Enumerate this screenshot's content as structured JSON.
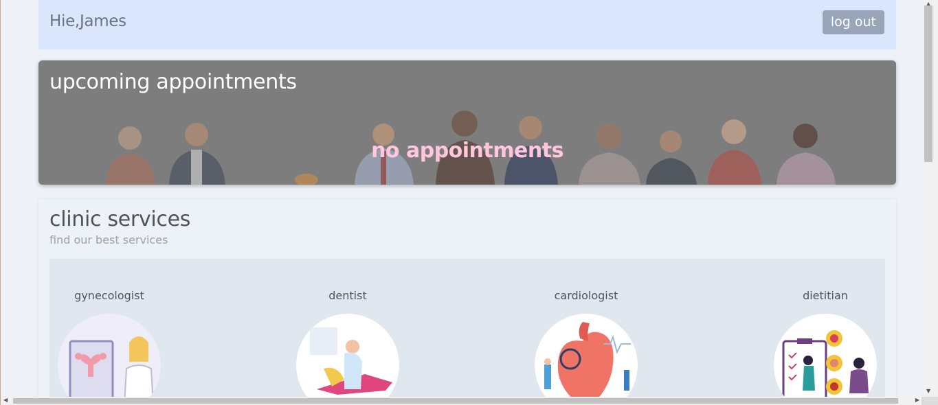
{
  "header": {
    "greeting": "Hie,James",
    "logout_label": "log out"
  },
  "appointments": {
    "title": "upcoming appointments",
    "empty_message": "no appointments"
  },
  "services": {
    "title": "clinic services",
    "subtitle": "find our best services",
    "items": [
      {
        "label": "gynecologist",
        "icon": "gynecologist-illustration"
      },
      {
        "label": "dentist",
        "icon": "dentist-illustration"
      },
      {
        "label": "cardiologist",
        "icon": "cardiologist-illustration"
      },
      {
        "label": "dietitian",
        "icon": "dietitian-illustration"
      }
    ]
  },
  "colors": {
    "header_bg": "#d9e6fc",
    "logout_bg": "#98a5b8",
    "empty_message": "#ffc6dc",
    "panel_bg": "#e1e7ef"
  }
}
